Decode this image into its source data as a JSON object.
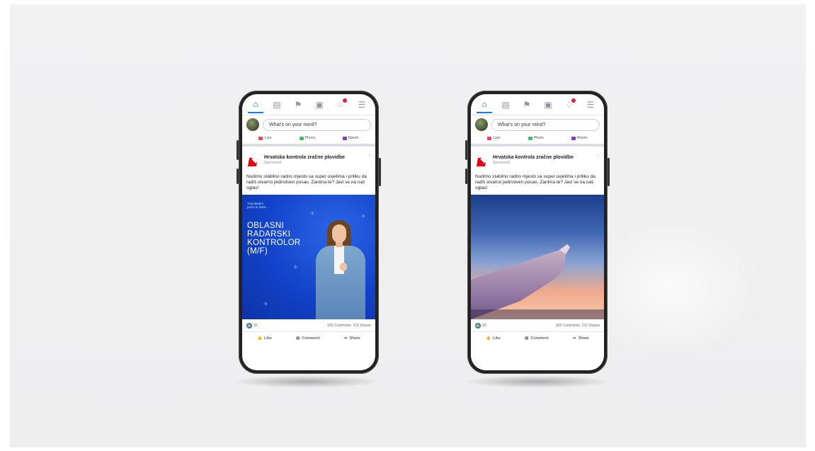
{
  "colors": {
    "background": "#f0f0f1",
    "fb_blue": "#1877f2",
    "ad_blue": "#1242c9",
    "brand_red": "#e30613"
  },
  "nav_icons": [
    "home-icon",
    "marketplace-icon",
    "flag-icon",
    "news-icon",
    "notifications-icon",
    "menu-icon"
  ],
  "phones": [
    {
      "composer": {
        "placeholder": "What's on your mind?",
        "live": "Live",
        "photo": "Photo",
        "room": "Room"
      },
      "post": {
        "page_name": "Hrvatska kontrola zračne plovidbe",
        "sponsored": "Sponsored",
        "text": "Nudimo stabilno radno mjesto sa super uvjetima i priliku da radiš stvarno jedinstven posao. Zanima te? Javi se na naš oglas!",
        "ad": {
          "small_lines": [
            "Tvoj idealni",
            "poziv te čeka..."
          ],
          "headline": [
            "OBLASNI",
            "RADARSKI",
            "KONTROLOR",
            "(M/F)"
          ]
        },
        "likes": "30",
        "comments": "332 Comments",
        "shares": "211 Shares",
        "like_label": "Like",
        "comment_label": "Comment",
        "share_label": "Share"
      }
    },
    {
      "composer": {
        "placeholder": "What's on your mind?",
        "live": "Live",
        "photo": "Photo",
        "room": "Room"
      },
      "post": {
        "page_name": "Hrvatska kontrola zračne plovidbe",
        "sponsored": "Sponsored",
        "text": "Nudimo stabilno radno mjesto sa super uvjetima i priliku da radiš stvarno jedinstven posao. Zanima te? Javi se na naš oglas!",
        "likes": "30",
        "comments": "332 Comments",
        "shares": "211 Shares",
        "like_label": "Like",
        "comment_label": "Comment",
        "share_label": "Share"
      }
    }
  ]
}
